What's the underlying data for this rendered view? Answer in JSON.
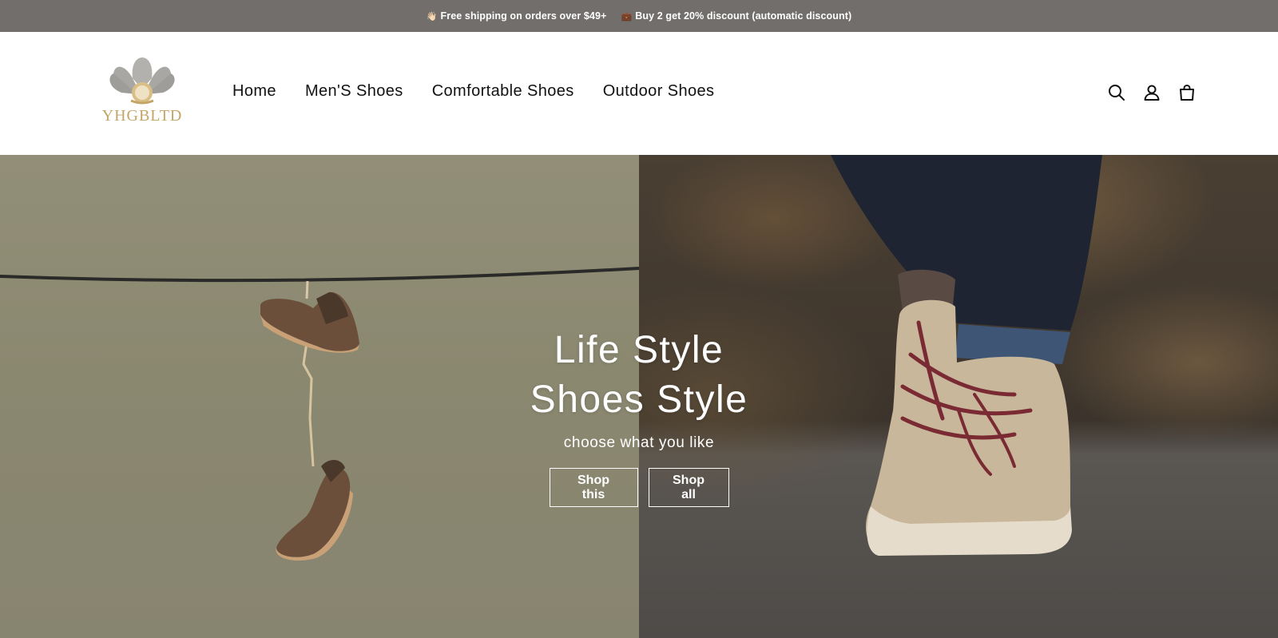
{
  "announcement": {
    "items": [
      {
        "emoji": "👋🏻",
        "text": "Free shipping on orders over $49+"
      },
      {
        "emoji": "💼",
        "text": "Buy 2 get 20% discount (automatic discount)"
      }
    ]
  },
  "header": {
    "logo_text": "YHGBLTD",
    "nav": [
      "Home",
      "Men'S Shoes",
      "Comfortable Shoes",
      "Outdoor Shoes"
    ],
    "icons": [
      "search-icon",
      "account-icon",
      "cart-icon"
    ]
  },
  "hero": {
    "title_line1": "Life Style",
    "title_line2": "Shoes Style",
    "subtitle": "choose what you like",
    "buttons": {
      "shop_this": "Shop this",
      "shop_all": "Shop all"
    }
  },
  "colors": {
    "announcement_bg": "#716e6b",
    "logo_gold": "#c3a568",
    "text": "#121212"
  }
}
